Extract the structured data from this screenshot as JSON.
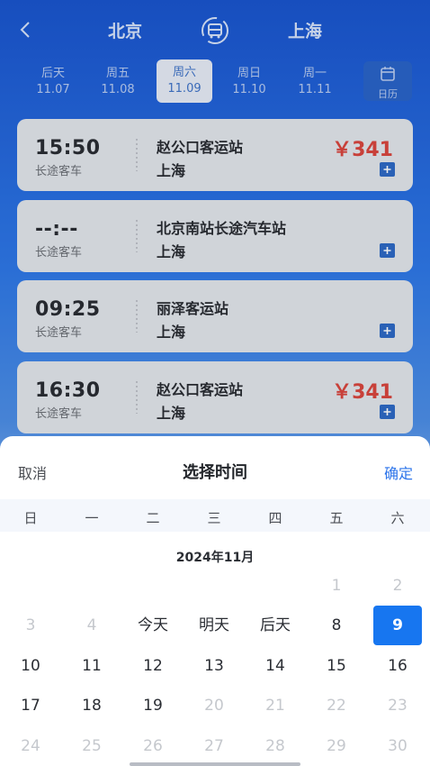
{
  "header": {
    "from_city": "北京",
    "to_city": "上海",
    "icons": {
      "back": "chevron-left-icon",
      "swap": "bus-icon"
    }
  },
  "date_tabs": [
    {
      "weekday": "后天",
      "date": "11.07",
      "active": false
    },
    {
      "weekday": "周五",
      "date": "11.08",
      "active": false
    },
    {
      "weekday": "周六",
      "date": "11.09",
      "active": true
    },
    {
      "weekday": "周日",
      "date": "11.10",
      "active": false
    },
    {
      "weekday": "周一",
      "date": "11.11",
      "active": false
    }
  ],
  "calendar_button": {
    "label": "日历",
    "icon": "calendar-icon"
  },
  "trips": [
    {
      "time": "15:50",
      "type": "长途客车",
      "departure": "赵公口客运站",
      "arrival": "上海",
      "price": "￥341"
    },
    {
      "time": "--:--",
      "type": "长途客车",
      "departure": "北京南站长途汽车站",
      "arrival": "上海",
      "price": ""
    },
    {
      "time": "09:25",
      "type": "长途客车",
      "departure": "丽泽客运站",
      "arrival": "上海",
      "price": ""
    },
    {
      "time": "16:30",
      "type": "长途客车",
      "departure": "赵公口客运站",
      "arrival": "上海",
      "price": "￥341"
    }
  ],
  "picker": {
    "cancel_label": "取消",
    "title": "选择时间",
    "confirm_label": "确定",
    "weekdays": [
      "日",
      "一",
      "二",
      "三",
      "四",
      "五",
      "六"
    ],
    "month_label": "2024年11月",
    "rows": [
      [
        {
          "t": ""
        },
        {
          "t": ""
        },
        {
          "t": ""
        },
        {
          "t": ""
        },
        {
          "t": ""
        },
        {
          "t": "1",
          "dim": true
        },
        {
          "t": "2",
          "dim": true
        }
      ],
      [
        {
          "t": "3",
          "dim": true
        },
        {
          "t": "4",
          "dim": true
        },
        {
          "t": "今天"
        },
        {
          "t": "明天"
        },
        {
          "t": "后天"
        },
        {
          "t": "8"
        },
        {
          "t": "9",
          "sel": true
        }
      ],
      [
        {
          "t": "10"
        },
        {
          "t": "11"
        },
        {
          "t": "12"
        },
        {
          "t": "13"
        },
        {
          "t": "14"
        },
        {
          "t": "15"
        },
        {
          "t": "16"
        }
      ],
      [
        {
          "t": "17"
        },
        {
          "t": "18"
        },
        {
          "t": "19"
        },
        {
          "t": "20",
          "dim": true
        },
        {
          "t": "21",
          "dim": true
        },
        {
          "t": "22",
          "dim": true
        },
        {
          "t": "23",
          "dim": true
        }
      ],
      [
        {
          "t": "24",
          "dim": true
        },
        {
          "t": "25",
          "dim": true
        },
        {
          "t": "26",
          "dim": true
        },
        {
          "t": "27",
          "dim": true
        },
        {
          "t": "28",
          "dim": true
        },
        {
          "t": "29",
          "dim": true
        },
        {
          "t": "30",
          "dim": true
        }
      ]
    ]
  },
  "colors": {
    "primary": "#1776f0",
    "price": "#d9463e",
    "header_bg": "#1f5fd6"
  }
}
